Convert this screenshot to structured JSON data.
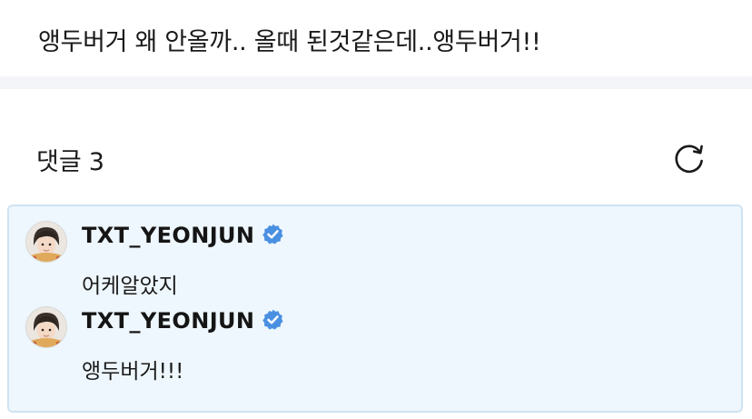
{
  "post": {
    "text": "앵두버거 왜 안올까.. 올때 된것같은데..앵두버거!!"
  },
  "comments_section": {
    "label": "댓글",
    "count": "3",
    "refresh_icon": "refresh-icon"
  },
  "comments": [
    {
      "author": "TXT_YEONJUN",
      "verified_icon": "verified-badge-icon",
      "text": "어케알았지"
    },
    {
      "author": "TXT_YEONJUN",
      "verified_icon": "verified-badge-icon",
      "text": "앵두버거!!!"
    }
  ],
  "colors": {
    "thread_background": "#eef7fd",
    "thread_border": "#cfe3f2",
    "verified_badge": "#4a90e2",
    "divider_band": "#f4f5f9"
  }
}
